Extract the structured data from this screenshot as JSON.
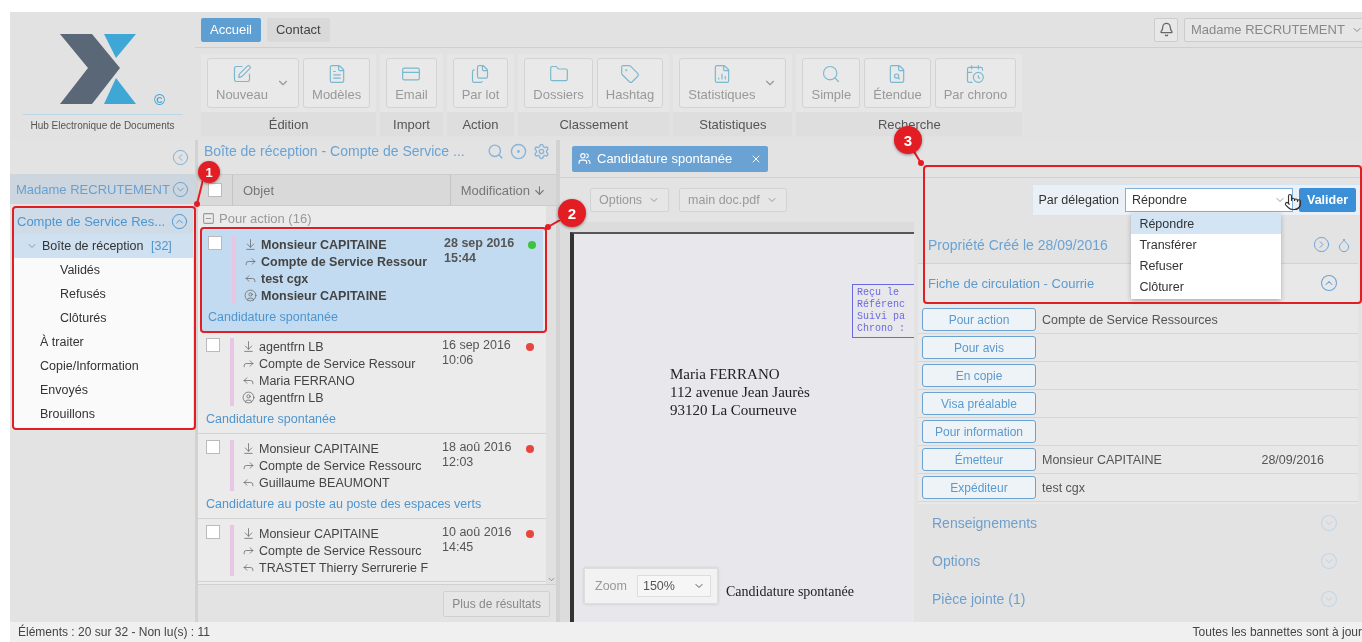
{
  "logo": {
    "mark": "©",
    "caption": "Hub Electronique de Documents"
  },
  "tabs": [
    {
      "label": "Accueil",
      "selected": true
    },
    {
      "label": "Contact",
      "selected": false
    }
  ],
  "user_menu": {
    "label": "Madame RECRUTEMENT"
  },
  "ribbon": [
    {
      "label": "Édition",
      "buttons": [
        {
          "label": "Nouveau",
          "dropdown": true
        },
        {
          "label": "Modèles",
          "dropdown": false
        }
      ]
    },
    {
      "label": "Import",
      "buttons": [
        {
          "label": "Email",
          "dropdown": false
        }
      ]
    },
    {
      "label": "Action",
      "buttons": [
        {
          "label": "Par lot",
          "dropdown": false
        }
      ]
    },
    {
      "label": "Classement",
      "buttons": [
        {
          "label": "Dossiers",
          "dropdown": false
        },
        {
          "label": "Hashtag",
          "dropdown": false
        }
      ]
    },
    {
      "label": "Statistiques",
      "buttons": [
        {
          "label": "Statistiques",
          "dropdown": true
        }
      ]
    },
    {
      "label": "Recherche",
      "buttons": [
        {
          "label": "Simple",
          "dropdown": false
        },
        {
          "label": "Étendue",
          "dropdown": false
        },
        {
          "label": "Par chrono",
          "dropdown": false
        }
      ]
    }
  ],
  "sidebar": {
    "user": "Madame RECRUTEMENT",
    "account": {
      "label": "Compte de Service Res...",
      "expanded": true
    },
    "items": [
      {
        "label": "Boîte de réception",
        "count": "[32]",
        "selected": true,
        "expanded": true,
        "children": [
          {
            "label": "Validés",
            "selected": false
          },
          {
            "label": "Refusés",
            "selected": false
          },
          {
            "label": "Clôturés",
            "selected": false
          }
        ]
      },
      {
        "label": "À traiter",
        "selected": false
      },
      {
        "label": "Copie/Information",
        "selected": false
      },
      {
        "label": "Envoyés",
        "selected": false
      },
      {
        "label": "Brouillons",
        "selected": false
      }
    ]
  },
  "list": {
    "title": "Boîte de réception - Compte de Service ...",
    "select_all": {
      "checked": false
    },
    "columns": [
      "Objet",
      "Modification"
    ],
    "group": {
      "label": "Pour action (16)",
      "expanded": true
    },
    "items": [
      {
        "lines": [
          {
            "kind": "in",
            "text": "Monsieur CAPITAINE"
          },
          {
            "kind": "to",
            "text": "Compte de Service Ressour"
          },
          {
            "kind": "reply",
            "text": "test cgx"
          },
          {
            "kind": "user",
            "text": "Monsieur CAPITAINE"
          }
        ],
        "date": "28 sep 2016",
        "time": "15:44",
        "subject": "Candidature spontanée",
        "unread": true,
        "selected": true,
        "checked": false,
        "color": "#3cc43c"
      },
      {
        "lines": [
          {
            "kind": "in",
            "text": "agentfrn LB"
          },
          {
            "kind": "to",
            "text": "Compte de Service Ressour"
          },
          {
            "kind": "reply",
            "text": "Maria FERRANO"
          },
          {
            "kind": "user",
            "text": "agentfrn LB"
          }
        ],
        "date": "16 sep 2016",
        "time": "10:06",
        "subject": "Candidature spontanée",
        "unread": false,
        "selected": false,
        "checked": false,
        "color": "#e8453c"
      },
      {
        "lines": [
          {
            "kind": "in",
            "text": "Monsieur CAPITAINE"
          },
          {
            "kind": "to",
            "text": "Compte de Service Ressourc"
          },
          {
            "kind": "reply",
            "text": "Guillaume BEAUMONT"
          }
        ],
        "date": "18 aoû 2016",
        "time": "12:03",
        "subject": "Candidature au poste au poste des espaces verts",
        "unread": false,
        "selected": false,
        "checked": false,
        "color": "#e8453c"
      },
      {
        "lines": [
          {
            "kind": "in",
            "text": "Monsieur CAPITAINE"
          },
          {
            "kind": "to",
            "text": "Compte de Service Ressourc"
          },
          {
            "kind": "reply",
            "text": "TRASTET Thierry Serrurerie F"
          }
        ],
        "date": "10 aoû 2016",
        "time": "14:45",
        "unread": false,
        "selected": false,
        "checked": false,
        "color": "#e8453c"
      }
    ],
    "more_button": "Plus de résultats"
  },
  "document": {
    "tab": {
      "label": "Candidature spontanée",
      "selected": true
    },
    "toolbar": [
      "Options",
      "main doc.pdf"
    ],
    "stamp": [
      "Reçu le",
      "Référenc",
      "Suivi pa",
      "Chrono :"
    ],
    "address": [
      "Maria FERRANO",
      "112 avenue Jean Jaurès",
      "93120 La Courneuve"
    ],
    "footer_text": "Candidature spontanée",
    "zoom": {
      "label": "Zoom",
      "value": "150%"
    }
  },
  "delegation": {
    "label": "Par délegation",
    "value": "Répondre",
    "button": "Valider",
    "open": true,
    "options": [
      {
        "label": "Répondre",
        "selected": true
      },
      {
        "label": "Transférer",
        "selected": false
      },
      {
        "label": "Refuser",
        "selected": false
      },
      {
        "label": "Clôturer",
        "selected": false
      }
    ]
  },
  "properties": {
    "header": "Propriété Créé le 28/09/2016",
    "section": {
      "title": "Fiche de circulation - Courrie",
      "expanded": true
    },
    "rows": [
      {
        "role": "Pour action",
        "name": "Compte de Service Ressources"
      },
      {
        "role": "Pour avis"
      },
      {
        "role": "En copie"
      },
      {
        "role": "Visa préalable"
      },
      {
        "role": "Pour information"
      },
      {
        "role": "Émetteur",
        "name": "Monsieur CAPITAINE",
        "date": "28/09/2016"
      },
      {
        "role": "Expéditeur",
        "name": "test cgx"
      }
    ],
    "collapsed": [
      {
        "title": "Renseignements",
        "expanded": false
      },
      {
        "title": "Options",
        "expanded": false
      },
      {
        "title": "Pièce jointe (1)",
        "expanded": false
      }
    ]
  },
  "annotations": [
    "1",
    "2",
    "3"
  ],
  "status_bar": {
    "left": "Éléments : 20 sur 32 - Non lu(s) : 11",
    "right": "Toutes les bannettes sont à jour"
  }
}
